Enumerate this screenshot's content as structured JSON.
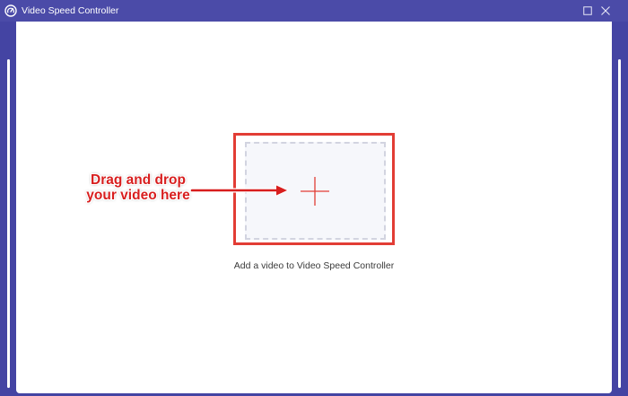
{
  "window": {
    "title": "Video Speed Controller"
  },
  "icons": {
    "app": "speedometer-icon",
    "maximize": "maximize-icon",
    "close": "close-icon",
    "add": "plus-icon",
    "arrow": "arrow-right-icon"
  },
  "colors": {
    "titlebar": "#4b4ba8",
    "frame": "#4444a3",
    "annotation_red": "#d81e1e",
    "highlight_red": "#e23d35",
    "drop_zone_bg": "#f6f7fb",
    "caption_text": "#3a3a3a"
  },
  "annotation": {
    "line1": "Drag and drop",
    "line2": "your video here"
  },
  "main": {
    "caption": "Add a video to Video Speed Controller"
  }
}
